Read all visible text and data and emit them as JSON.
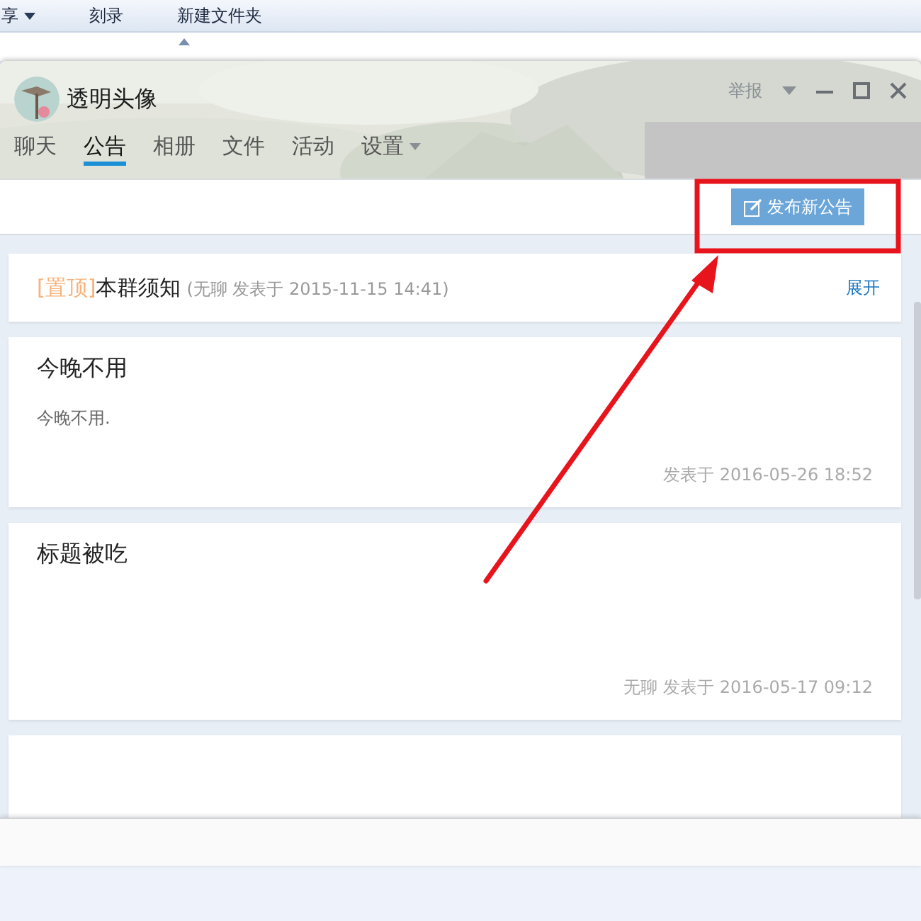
{
  "explorer": {
    "toolbar": [
      {
        "kind": "menu",
        "label": "享"
      },
      {
        "kind": "button",
        "label": "刻录"
      },
      {
        "kind": "button",
        "label": "新建文件夹"
      }
    ]
  },
  "window": {
    "title": "透明头像",
    "report": "举报"
  },
  "tabs": [
    {
      "label": "聊天",
      "selected": false,
      "kind": "tab"
    },
    {
      "label": "公告",
      "selected": true,
      "kind": "tab"
    },
    {
      "label": "相册",
      "selected": false,
      "kind": "tab"
    },
    {
      "label": "文件",
      "selected": false,
      "kind": "tab"
    },
    {
      "label": "活动",
      "selected": false,
      "kind": "tab"
    },
    {
      "label": "设置",
      "selected": false,
      "kind": "menu"
    }
  ],
  "toolbar": {
    "button": "发布新公告"
  },
  "notices": [
    {
      "kind": "pinned",
      "tag": "[置顶]",
      "title": "本群须知",
      "meta": "(无聊 发表于 2015-11-15 14:41)",
      "action": "展开"
    },
    {
      "kind": "normal",
      "title": "今晚不用",
      "body": "今晚不用.",
      "meta": "发表于 2016-05-26 18:52"
    },
    {
      "kind": "normal",
      "title": "标题被吃",
      "meta": "无聊 发表于 2016-05-17 09:12"
    },
    {
      "kind": "normal"
    }
  ],
  "annotation": {
    "highlight_box": true,
    "arrow": true
  }
}
